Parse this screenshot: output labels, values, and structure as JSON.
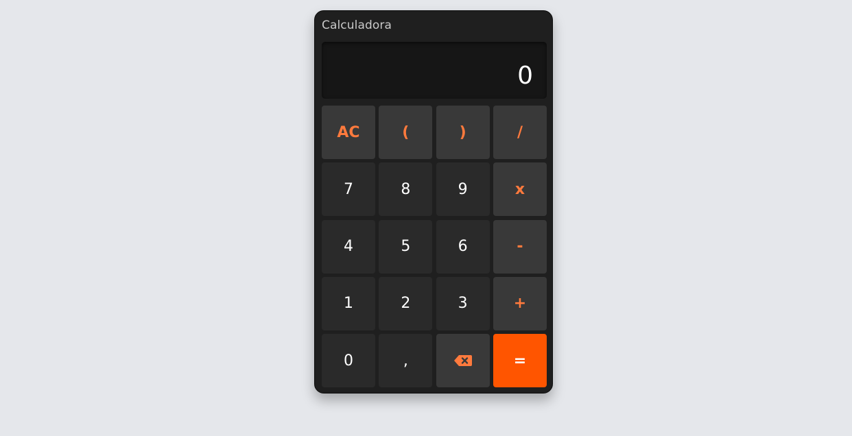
{
  "app": {
    "title": "Calculadora"
  },
  "display": {
    "value": "0"
  },
  "keys": {
    "ac": "AC",
    "open_paren": "(",
    "close_paren": ")",
    "divide": "/",
    "seven": "7",
    "eight": "8",
    "nine": "9",
    "multiply": "x",
    "four": "4",
    "five": "5",
    "six": "6",
    "minus": "-",
    "one": "1",
    "two": "2",
    "three": "3",
    "plus": "+",
    "zero": "0",
    "comma": ",",
    "backspace_icon": "backspace-icon",
    "equals": "="
  },
  "colors": {
    "accent": "#ff7a3d",
    "equals_bg": "#ff5500",
    "panel_bg": "#1f1f1f",
    "page_bg": "#e5e7eb"
  }
}
